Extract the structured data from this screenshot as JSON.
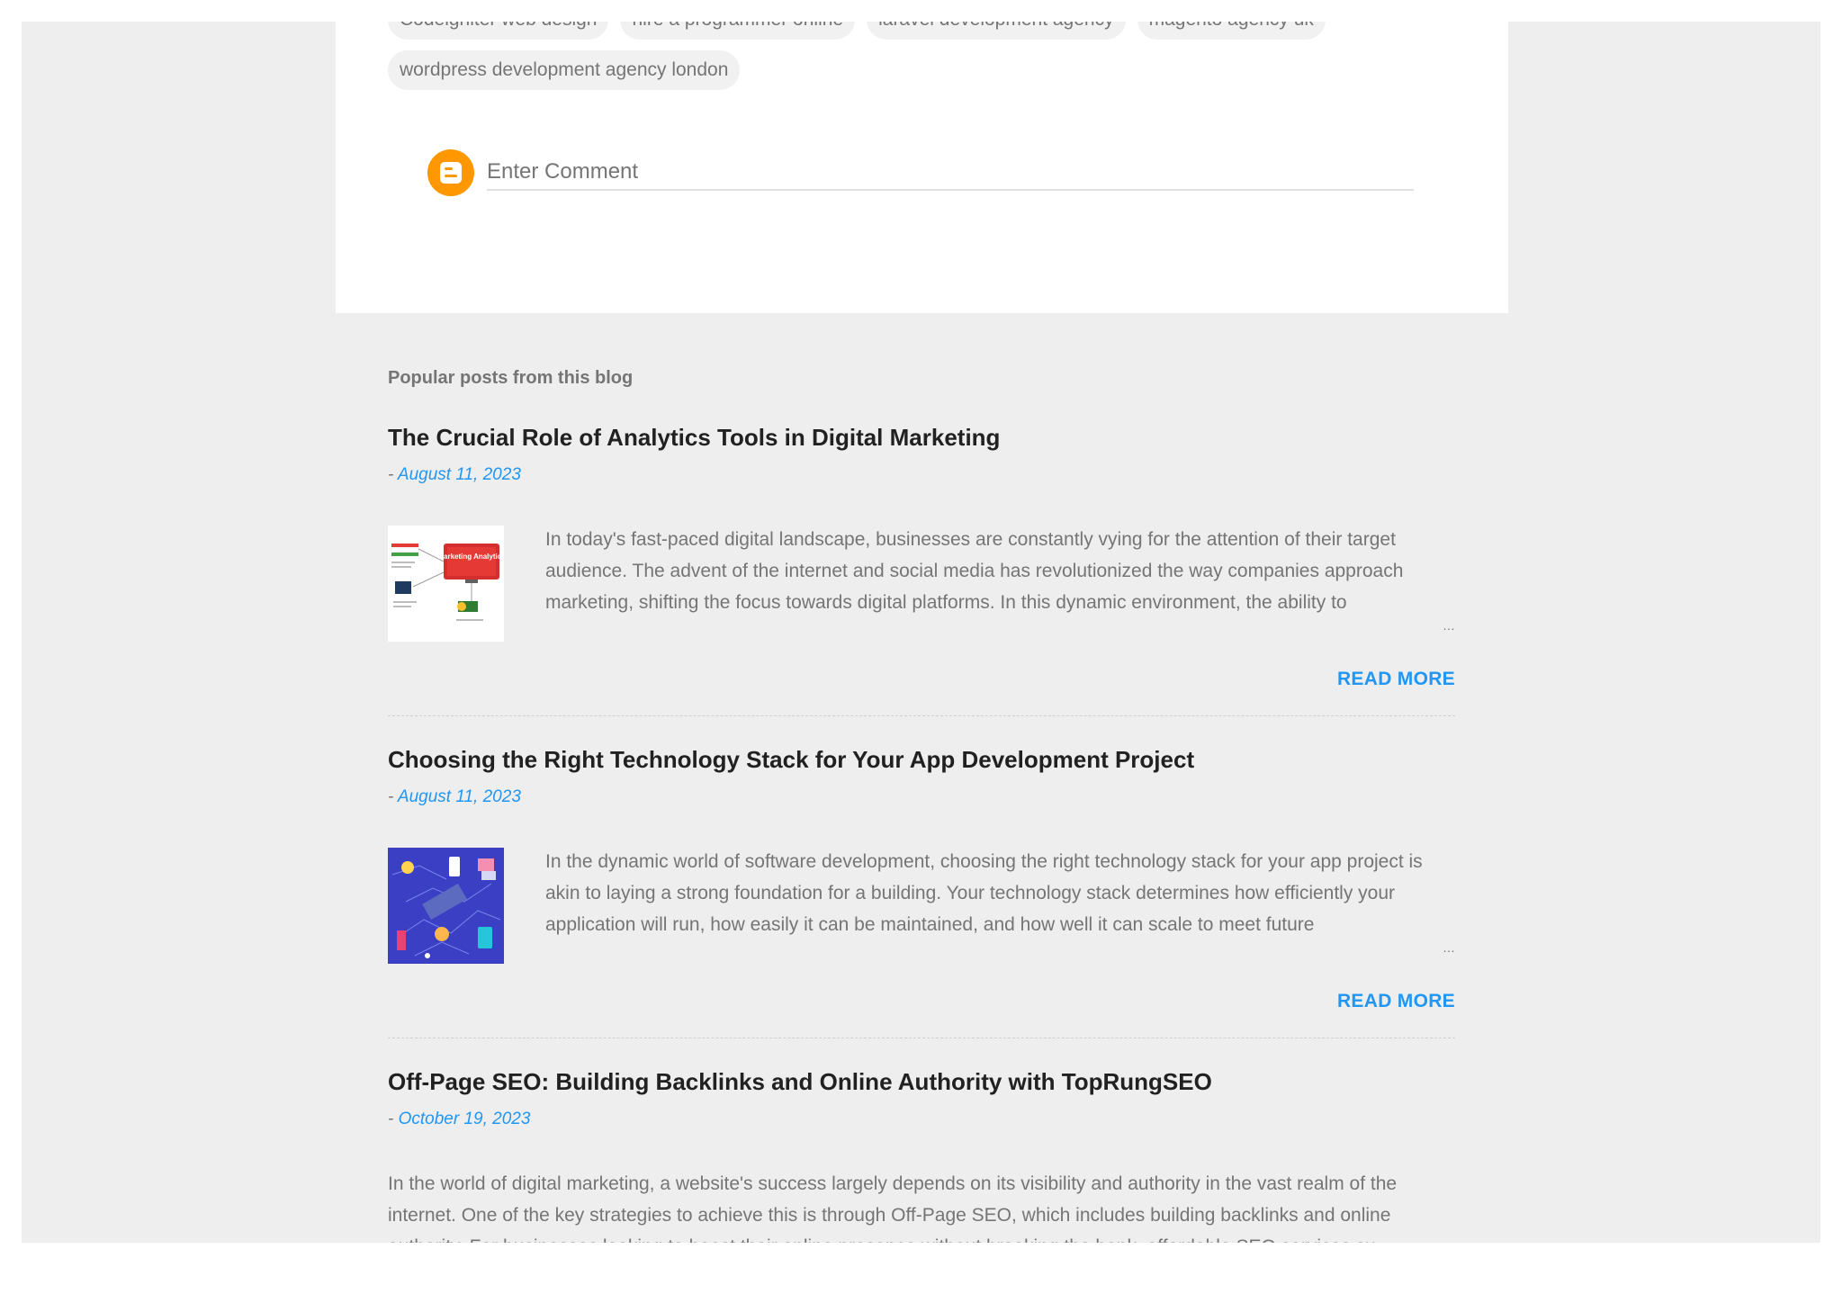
{
  "labels": {
    "row1": [
      "Codeigniter web design",
      "hire a programmer online",
      "laravel development agency",
      "magento agency uk"
    ],
    "row2": [
      "wordpress development agency london"
    ]
  },
  "comment": {
    "placeholder": "Enter Comment",
    "avatar_icon": "blogger-logo-icon"
  },
  "popular": {
    "title": "Popular posts from this blog",
    "posts": [
      {
        "title": "The Crucial Role of Analytics Tools in Digital Marketing",
        "meta_prefix": "- ",
        "date": "August 11, 2023",
        "snippet": "In today's fast-paced digital landscape, businesses are constantly vying for the attention of their target audience. The advent of the internet and social media has revolutionized the way companies approach marketing, shifting the focus towards digital platforms. In this dynamic environment, the ability to",
        "ellipsis": "…",
        "read_more": "READ MORE",
        "thumb_text": "Marketing Analytics"
      },
      {
        "title": "Choosing the Right Technology Stack for Your App Development Project",
        "meta_prefix": "- ",
        "date": "August 11, 2023",
        "snippet": "In the dynamic world of software development, choosing the right technology stack for your app project is akin to laying a strong foundation for a building. Your technology stack determines how efficiently your application will run, how easily it can be maintained, and how well it can scale to meet future",
        "ellipsis": "…",
        "read_more": "READ MORE"
      },
      {
        "title": "Off-Page SEO: Building Backlinks and Online Authority with TopRungSEO",
        "meta_prefix": "- ",
        "date": "October 19, 2023",
        "snippet": " In the world of digital marketing, a website's success largely depends on its visibility and authority in the vast realm of the internet. One of the key strategies to achieve this is through Off-Page SEO, which includes building backlinks and online authority. For businesses looking to boost their online presence without breaking the bank, affordable SEO services su",
        "ellipsis": "…"
      }
    ]
  },
  "colors": {
    "accent": "#2196f3",
    "blogger_orange": "#ff9800",
    "page_bg": "#eeeeee"
  }
}
